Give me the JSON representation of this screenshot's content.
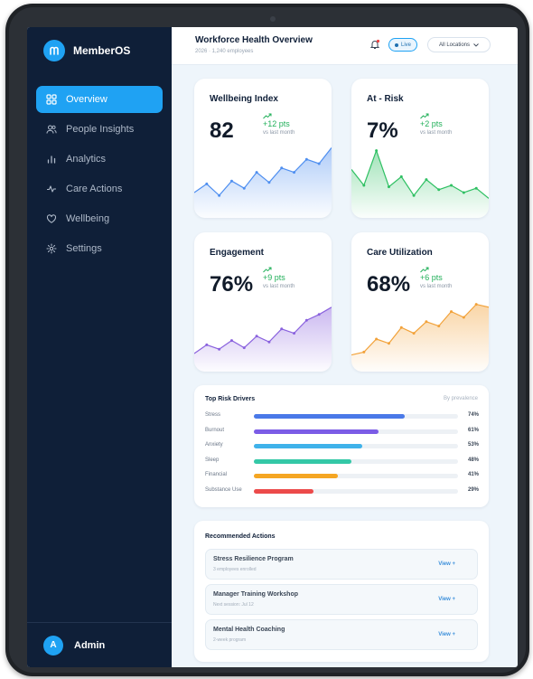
{
  "sidebar": {
    "brand": "MemberOS",
    "items": [
      {
        "label": "Overview",
        "icon": "grid-icon",
        "active": true
      },
      {
        "label": "People Insights",
        "icon": "people-icon"
      },
      {
        "label": "Analytics",
        "icon": "bar-chart-icon"
      },
      {
        "label": "Care Actions",
        "icon": "pulse-icon"
      },
      {
        "label": "Wellbeing",
        "icon": "heart-icon"
      },
      {
        "label": "Settings",
        "icon": "gear-icon"
      }
    ],
    "user": {
      "initial": "A",
      "name": "Admin"
    }
  },
  "header": {
    "title": "Workforce Health Overview",
    "subtitle": "2026 · 1,240 employees",
    "live_label": "Live",
    "location": "All Locations"
  },
  "kpis": [
    {
      "title": "Wellbeing Index",
      "value": "82",
      "delta": "+12 pts",
      "sub": "vs last month",
      "color": "#4f8ff0",
      "trend": [
        0.3,
        0.42,
        0.26,
        0.46,
        0.36,
        0.58,
        0.44,
        0.64,
        0.58,
        0.76,
        0.7,
        0.92
      ]
    },
    {
      "title": "At - Risk",
      "value": "7%",
      "delta": "+2 pts",
      "sub": "vs last month",
      "color": "#2fc063",
      "trend": [
        0.62,
        0.4,
        0.88,
        0.38,
        0.52,
        0.26,
        0.48,
        0.34,
        0.4,
        0.3,
        0.36,
        0.22
      ]
    },
    {
      "title": "Engagement",
      "value": "76%",
      "delta": "+9 pts",
      "sub": "vs last month",
      "color": "#8a62de",
      "trend": [
        0.2,
        0.32,
        0.26,
        0.38,
        0.28,
        0.44,
        0.36,
        0.54,
        0.48,
        0.66,
        0.74,
        0.84
      ]
    },
    {
      "title": "Care Utilization",
      "value": "68%",
      "delta": "+6 pts",
      "sub": "vs last month",
      "color": "#f2a23a",
      "trend": [
        0.18,
        0.22,
        0.4,
        0.34,
        0.56,
        0.48,
        0.64,
        0.58,
        0.78,
        0.7,
        0.88,
        0.84
      ]
    }
  ],
  "risk": {
    "title": "Top Risk Drivers",
    "hint": "By prevalence",
    "drivers": [
      {
        "label": "Stress",
        "pct": "74%",
        "value": 74,
        "color": "#4a79e8"
      },
      {
        "label": "Burnout",
        "pct": "61%",
        "value": 61,
        "color": "#7b5ce6"
      },
      {
        "label": "Anxiety",
        "pct": "53%",
        "value": 53,
        "color": "#3fb2ea"
      },
      {
        "label": "Sleep",
        "pct": "48%",
        "value": 48,
        "color": "#34c8a7"
      },
      {
        "label": "Financial",
        "pct": "41%",
        "value": 41,
        "color": "#f5a623"
      },
      {
        "label": "Substance Use",
        "pct": "29%",
        "value": 29,
        "color": "#ec4a4a"
      }
    ]
  },
  "actions": {
    "title": "Recommended Actions",
    "view_label": "View +",
    "items": [
      {
        "title": "Stress Resilience Program",
        "sub": "3 employees enrolled"
      },
      {
        "title": "Manager Training Workshop",
        "sub": "Next session: Jul 12"
      },
      {
        "title": "Mental Health Coaching",
        "sub": "2-week program"
      }
    ]
  }
}
